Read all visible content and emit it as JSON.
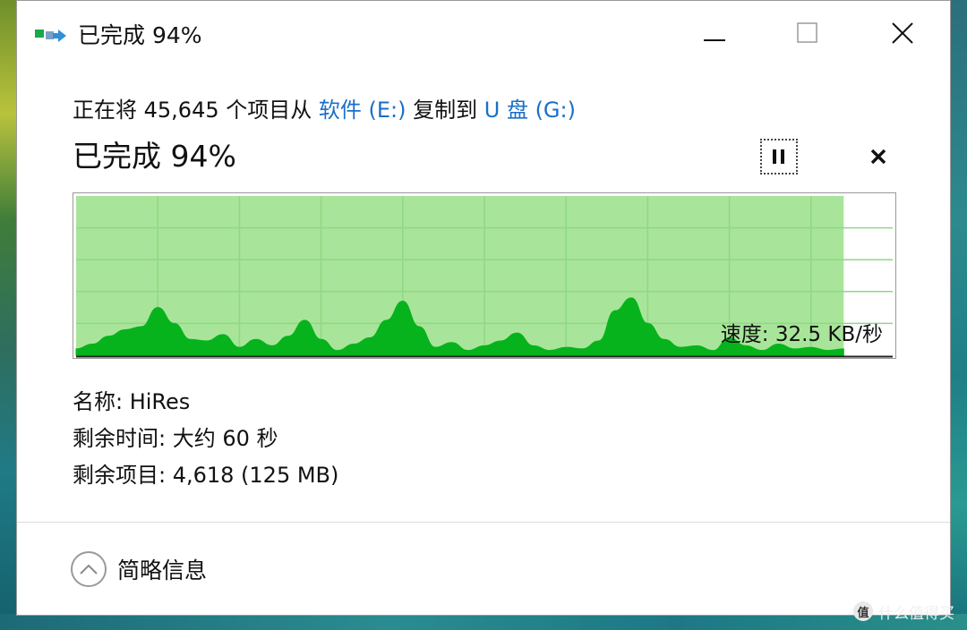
{
  "window": {
    "title": "已完成 94%",
    "icon": "copy-transfer-icon"
  },
  "controls": {
    "minimize_icon": "minimize-icon",
    "maximize_icon": "maximize-icon",
    "close_icon": "close-icon"
  },
  "copy": {
    "prefix": "正在将 45,645 个项目从 ",
    "source": "软件 (E:)",
    "middle": " 复制到 ",
    "destination": "U 盘 (G:)"
  },
  "progress": {
    "heading": "已完成 94%",
    "percent": 94,
    "pause_icon": "pause-icon",
    "cancel_icon": "cancel-icon"
  },
  "speed": {
    "label": "速度: 32.5 KB/秒"
  },
  "details": {
    "name": "名称: HiRes",
    "time_remaining": "剩余时间: 大约 60 秒",
    "items_remaining": "剩余项目: 4,618 (125 MB)"
  },
  "footer": {
    "toggle_label": "简略信息",
    "toggle_icon": "chevron-up-icon"
  },
  "watermark": {
    "badge": "值",
    "text": "什么值得买"
  },
  "chart_data": {
    "type": "area",
    "x": [
      0,
      2,
      4,
      6,
      8,
      10,
      12,
      14,
      16,
      18,
      20,
      22,
      24,
      26,
      28,
      30,
      32,
      34,
      36,
      38,
      40,
      42,
      44,
      46,
      48,
      50,
      52,
      54,
      56,
      58,
      60,
      62,
      64,
      66,
      68,
      70,
      72,
      74,
      76,
      78,
      80,
      82,
      84,
      86,
      88,
      90,
      92,
      94
    ],
    "values": [
      4,
      7,
      12,
      16,
      18,
      30,
      20,
      10,
      9,
      13,
      5,
      10,
      6,
      12,
      22,
      10,
      3,
      7,
      11,
      22,
      34,
      18,
      5,
      8,
      3,
      6,
      9,
      14,
      6,
      3,
      5,
      4,
      9,
      28,
      36,
      20,
      10,
      5,
      6,
      3,
      11,
      6,
      3,
      7,
      4,
      5,
      3,
      4
    ],
    "progress_percent": 94,
    "xlim": [
      0,
      100
    ],
    "ylim": [
      0,
      100
    ],
    "grid": true,
    "colors": {
      "fill": "#a8e59a",
      "grid": "#8fd884",
      "line": "#06b31c"
    }
  }
}
